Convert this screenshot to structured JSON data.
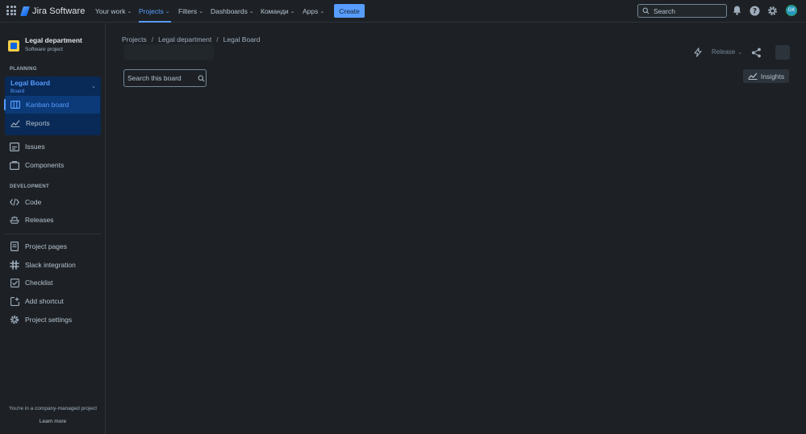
{
  "topnav": {
    "app_name": "Jira Software",
    "items": [
      {
        "label": "Your work",
        "active": false
      },
      {
        "label": "Projects",
        "active": true
      },
      {
        "label": "Filters",
        "active": false
      },
      {
        "label": "Dashboards",
        "active": false
      },
      {
        "label": "Команди",
        "active": false
      },
      {
        "label": "Apps",
        "active": false
      }
    ],
    "create_label": "Create",
    "search_placeholder": "Search",
    "avatar_initials": "GK",
    "icons": [
      "apps-grid-icon",
      "bell-icon",
      "help-icon",
      "settings-icon"
    ]
  },
  "sidebar": {
    "project_name": "Legal department",
    "project_type": "Software project",
    "planning_label": "PLANNING",
    "board": {
      "title": "Legal Board",
      "subtitle": "Board"
    },
    "planning_items": [
      {
        "label": "Kanban board",
        "icon": "board-icon",
        "selected": true
      },
      {
        "label": "Reports",
        "icon": "chart-icon",
        "selected": false
      }
    ],
    "other_items": [
      {
        "label": "Issues",
        "icon": "issues-icon"
      },
      {
        "label": "Components",
        "icon": "components-icon"
      }
    ],
    "development_label": "DEVELOPMENT",
    "development_items": [
      {
        "label": "Code",
        "icon": "code-icon"
      },
      {
        "label": "Releases",
        "icon": "ship-icon"
      }
    ],
    "extra_items": [
      {
        "label": "Project pages",
        "icon": "page-icon"
      },
      {
        "label": "Slack integration",
        "icon": "slack-icon"
      },
      {
        "label": "Checklist",
        "icon": "checkbox-icon"
      },
      {
        "label": "Add shortcut",
        "icon": "add-shortcut-icon"
      },
      {
        "label": "Project settings",
        "icon": "gear-icon"
      }
    ],
    "footer_text": "You're in a company-managed project",
    "footer_link": "Learn more"
  },
  "main": {
    "breadcrumbs": [
      "Projects",
      "Legal department",
      "Legal Board"
    ],
    "release_label": "Release",
    "search_placeholder": "Search this board",
    "insights_label": "Insights"
  },
  "colors": {
    "background": "#1d2125",
    "accent": "#579dff",
    "selected_bg": "#0c3a78"
  }
}
